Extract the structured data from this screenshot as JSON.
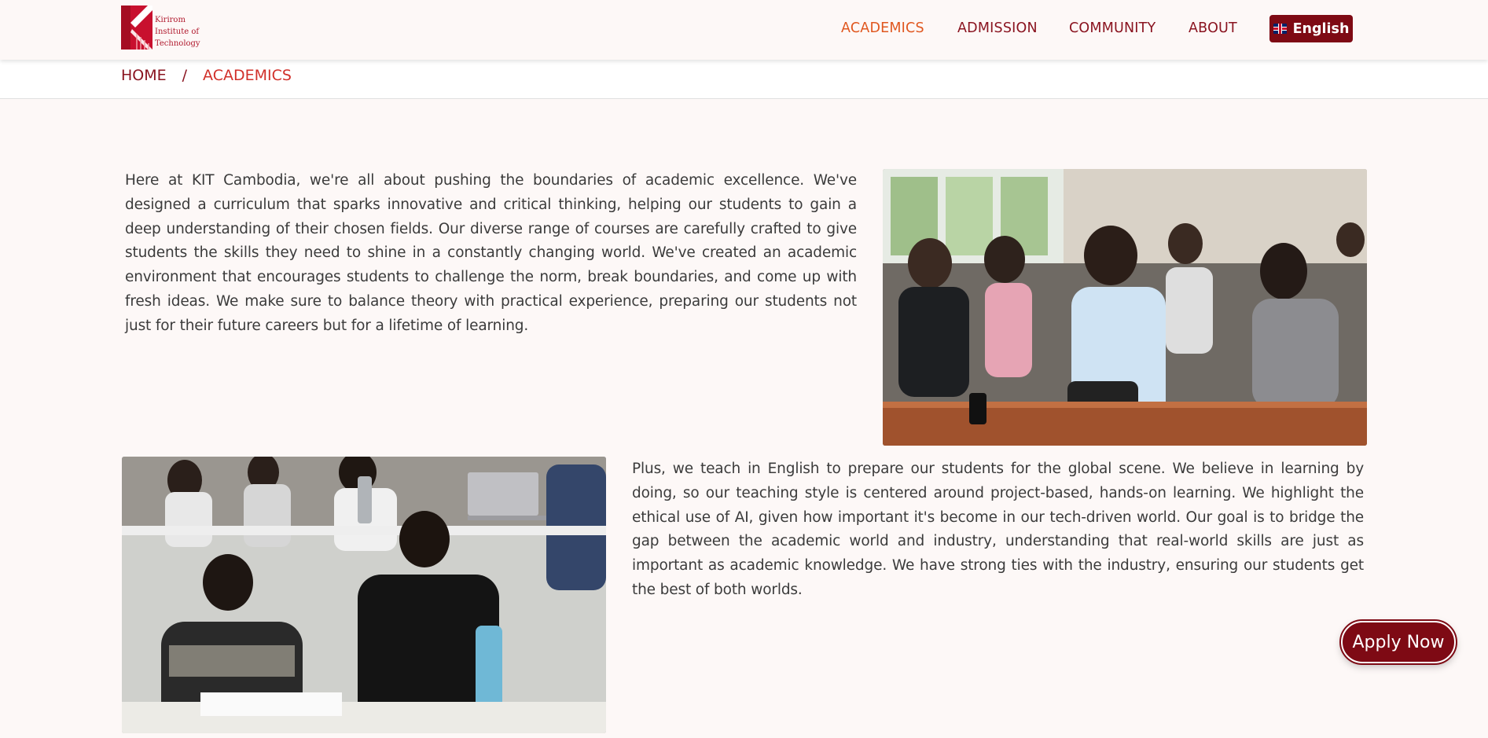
{
  "brand": {
    "logo_lines": [
      "Kirirom",
      "Institute of",
      "Technology"
    ],
    "accent_color": "#7e0a14",
    "active_color": "#e0571f"
  },
  "nav": {
    "items": [
      {
        "label": "ACADEMICS",
        "active": true
      },
      {
        "label": "ADMISSION",
        "active": false
      },
      {
        "label": "COMMUNITY",
        "active": false
      },
      {
        "label": "ABOUT",
        "active": false
      }
    ],
    "language": {
      "label": "English",
      "icon": "uk-flag-icon"
    }
  },
  "breadcrumb": {
    "home": "HOME",
    "separator": "/",
    "current": "ACADEMICS"
  },
  "content": {
    "paragraph1": "Here at KIT Cambodia, we're all about pushing the boundaries of academic excellence. We've designed a curriculum that sparks innovative and critical thinking, helping our students to gain a deep understanding of their chosen fields. Our diverse range of courses are carefully crafted to give students the skills they need to shine in a constantly changing world. We've created an academic environment that encourages students to challenge the norm, break boundaries, and come up with fresh ideas. We make sure to balance theory with practical experience, preparing our students not just for their future careers but for a lifetime of learning.",
    "paragraph2": "Plus, we teach in English to prepare our students for the global scene. We believe in learning by doing, so our teaching style is centered around project-based, hands-on learning. We highlight the ethical use of AI, given how important it's become in our tech-driven world. Our goal is to bridge the gap between the academic world and industry, understanding that real-world skills are just as important as academic knowledge. We have strong ties with the industry, ensuring our students get the best of both worlds."
  },
  "cta": {
    "apply_label": "Apply Now"
  }
}
